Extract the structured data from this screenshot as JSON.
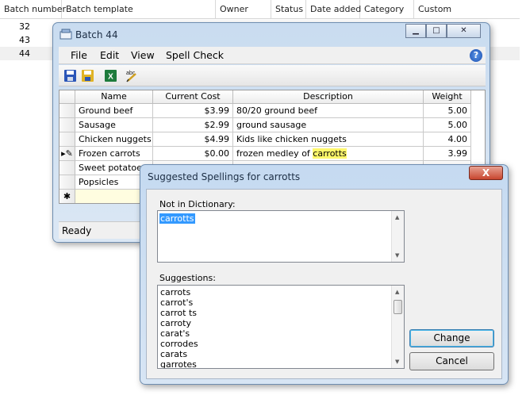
{
  "background": {
    "columns": [
      "Batch number",
      "Batch template",
      "Owner",
      "Status",
      "Date added",
      "Category",
      "Custom"
    ],
    "batch_numbers": [
      "32",
      "43",
      "44"
    ]
  },
  "batch_window": {
    "title": "Batch 44",
    "menu": [
      "File",
      "Edit",
      "View",
      "Spell Check"
    ],
    "columns": [
      "Name",
      "Current Cost",
      "Description",
      "Weight"
    ],
    "rows": [
      {
        "name": "Ground beef",
        "cost": "$3.99",
        "desc": "80/20 ground beef",
        "weight": "5.00"
      },
      {
        "name": "Sausage",
        "cost": "$2.99",
        "desc": "ground sausage",
        "weight": "5.00"
      },
      {
        "name": "Chicken nuggets",
        "cost": "$4.99",
        "desc": "Kids like chicken nuggets",
        "weight": "4.00"
      },
      {
        "name": "Frozen carrots",
        "cost": "$0.00",
        "desc_prefix": "frozen medley of ",
        "desc_highlight": "carrotts",
        "weight": "3.99"
      },
      {
        "name": "Sweet potatoes",
        "cost": "",
        "desc": "",
        "weight": ""
      },
      {
        "name": "Popsicles",
        "cost": "",
        "desc": "",
        "weight": ""
      }
    ],
    "status": "Ready",
    "new_row_marker": "✱"
  },
  "spell_dialog": {
    "title": "Suggested Spellings for carrotts",
    "close_label": "X",
    "not_in_dict_label": "Not in Dictionary:",
    "not_in_dict_value": "carrotts",
    "suggestions_label": "Suggestions:",
    "suggestions": [
      "carrots",
      "carrot's",
      "carrot ts",
      "carroty",
      "carat's",
      "corrodes",
      "carats",
      "garrotes"
    ],
    "change_label": "Change",
    "cancel_label": "Cancel"
  },
  "colors": {
    "highlight": "#fff86b",
    "selection": "#3399ff"
  }
}
